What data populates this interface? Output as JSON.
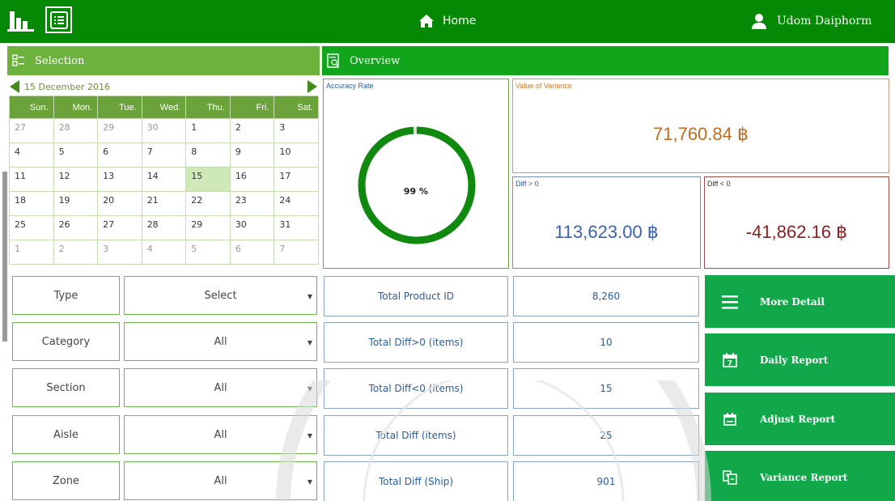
{
  "topbar": {
    "home_label": "Home",
    "user_name": "Udom Daiphorm"
  },
  "selection": {
    "header": "Selection",
    "calendar": {
      "current_date": "15 December 2016",
      "weekdays": [
        "Sun.",
        "Mon.",
        "Tue.",
        "Wed.",
        "Thu.",
        "Fri.",
        "Sat."
      ],
      "weeks": [
        [
          "27",
          "28",
          "29",
          "30",
          "1",
          "2",
          "3"
        ],
        [
          "4",
          "5",
          "6",
          "7",
          "8",
          "9",
          "10"
        ],
        [
          "11",
          "12",
          "13",
          "14",
          "15",
          "16",
          "17"
        ],
        [
          "18",
          "19",
          "20",
          "21",
          "22",
          "23",
          "24"
        ],
        [
          "25",
          "26",
          "27",
          "28",
          "29",
          "30",
          "31"
        ],
        [
          "1",
          "2",
          "3",
          "4",
          "5",
          "6",
          "7"
        ]
      ],
      "selected_day": "15"
    },
    "filters": [
      {
        "label": "Type",
        "value": "Select"
      },
      {
        "label": "Category",
        "value": "All"
      },
      {
        "label": "Section",
        "value": "All"
      },
      {
        "label": "Aisle",
        "value": "All"
      },
      {
        "label": "Zone",
        "value": "All"
      }
    ]
  },
  "overview": {
    "header": "Overview",
    "accuracy": {
      "label": "Accuracy Rate",
      "value_text": "99 %",
      "percent": 99
    },
    "variance": {
      "label": "Value of Variance",
      "value": "71,760.84 ฿"
    },
    "diff_pos": {
      "label": "Diff > 0",
      "value": "113,623.00 ฿"
    },
    "diff_neg": {
      "label": "Diff < 0",
      "value": "-41,862.16 ฿"
    },
    "stats": [
      {
        "label": "Total Product ID",
        "value": "8,260"
      },
      {
        "label": "Total Diff>0 (items)",
        "value": "10"
      },
      {
        "label": "Total Diff<0 (items)",
        "value": "15"
      },
      {
        "label": "Total Diff (items)",
        "value": "25"
      },
      {
        "label": "Total Diff (Ship)",
        "value": "901"
      }
    ]
  },
  "actions": [
    {
      "label": "More Detail",
      "icon": "menu-icon"
    },
    {
      "label": "Daily Report",
      "icon": "calendar-7-icon"
    },
    {
      "label": "Adjust Report",
      "icon": "calendar-icon"
    },
    {
      "label": "Variance Report",
      "icon": "compare-doc-icon"
    }
  ],
  "colors": {
    "topbar": "#058905",
    "selection_header": "#6cb23c",
    "overview_header": "#10a51a",
    "action_button": "#11a84a",
    "donut": "#0f8a0f"
  }
}
